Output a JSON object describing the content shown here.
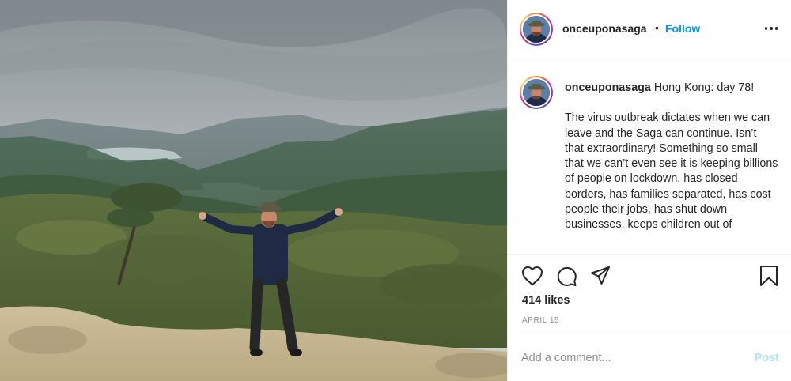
{
  "post": {
    "username": "onceuponasaga",
    "follow_label": "Follow",
    "separator": "•",
    "caption_title": "Hong Kong: day 78!",
    "caption_body": "The virus outbreak dictates when we can leave and the Saga can continue. Isn’t that extraordinary! Something so small that we can’t even see it is keeping billions of people on lockdown, has closed borders, has families separated, has cost people their jobs, has shut down businesses, keeps children out of",
    "likes": "414 likes",
    "date": "APRIL 15"
  },
  "comment": {
    "placeholder": "Add a comment...",
    "post_label": "Post"
  },
  "icons": {
    "more": "more-options-icon",
    "like": "heart-icon",
    "comment": "comment-bubble-icon",
    "share": "paper-plane-icon",
    "save": "bookmark-icon"
  },
  "colors": {
    "follow": "#0095f6",
    "post_disabled": "#b2dffc",
    "muted": "#8e8e8e",
    "text": "#262626"
  }
}
